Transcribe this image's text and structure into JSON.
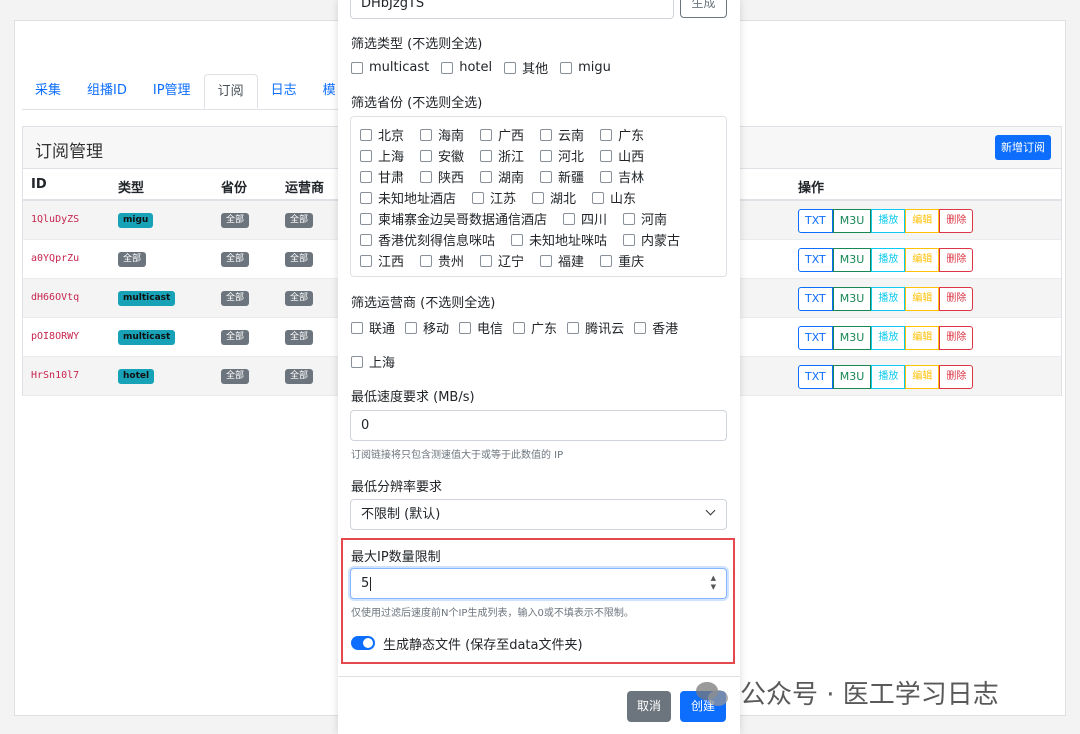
{
  "background": {
    "tabs": [
      "采集",
      "组播ID",
      "IP管理",
      "订阅",
      "日志",
      "模"
    ],
    "active_tab": 3,
    "card_title": "订阅管理",
    "new_button": "新增订阅",
    "columns": [
      "ID",
      "类型",
      "省份",
      "运营商",
      "操作"
    ],
    "rows": [
      {
        "id": "1QluDyZS",
        "type": "migu",
        "province": "全部",
        "operator": "全部"
      },
      {
        "id": "a0YQprZu",
        "type": "全部",
        "province": "全部",
        "operator": "全部"
      },
      {
        "id": "dH66OVtq",
        "type": "multicast",
        "province": "全部",
        "operator": "全部"
      },
      {
        "id": "pOI8ORWY",
        "type": "multicast",
        "province": "全部",
        "operator": "全部"
      },
      {
        "id": "HrSn10l7",
        "type": "hotel",
        "province": "全部",
        "operator": "全部"
      }
    ],
    "row_actions": [
      "TXT",
      "M3U",
      "播放",
      "编辑",
      "删除"
    ]
  },
  "modal": {
    "token_value": "DHbJzgTS",
    "generate_label": "生成",
    "type_filter_label": "筛选类型 (不选则全选)",
    "types": [
      "multicast",
      "hotel",
      "其他",
      "migu"
    ],
    "province_filter_label": "筛选省份 (不选则全选)",
    "province_lines": [
      [
        "北京",
        "海南",
        "广西",
        "云南",
        "广东"
      ],
      [
        "上海",
        "安徽",
        "浙江",
        "河北",
        "山西"
      ],
      [
        "甘肃",
        "陕西",
        "湖南",
        "新疆",
        "吉林"
      ],
      [
        "未知地址酒店",
        "江苏",
        "湖北",
        "山东"
      ],
      [
        "柬埔寨金边吴哥数据通信酒店",
        "四川",
        "河南"
      ],
      [
        "香港优刻得信息咪咕",
        "未知地址咪咕",
        "内蒙古"
      ],
      [
        "江西",
        "贵州",
        "辽宁",
        "福建",
        "重庆"
      ]
    ],
    "operator_filter_label": "筛选运营商 (不选则全选)",
    "operators": [
      "联通",
      "移动",
      "电信",
      "广东",
      "腾讯云",
      "香港"
    ],
    "operators_line2": [
      "上海"
    ],
    "min_speed_label": "最低速度要求 (MB/s)",
    "min_speed_value": "0",
    "min_speed_hint": "订阅链接将只包含测速值大于或等于此数值的 IP",
    "min_resolution_label": "最低分辨率要求",
    "min_resolution_value": "不限制 (默认)",
    "max_ip_label": "最大IP数量限制",
    "max_ip_value": "5",
    "max_ip_hint": "仅使用过滤后速度前N个IP生成列表，输入0或不填表示不限制。",
    "static_file_label": "生成静态文件 (保存至data文件夹)",
    "static_file_on": true,
    "cancel_label": "取消",
    "create_label": "创建"
  },
  "watermark": "公众号 · 医工学习日志",
  "colors": {
    "primary": "#0d6efd",
    "highlight": "#e5484d",
    "badge": "#17a2b8",
    "secondary": "#6c757d"
  }
}
